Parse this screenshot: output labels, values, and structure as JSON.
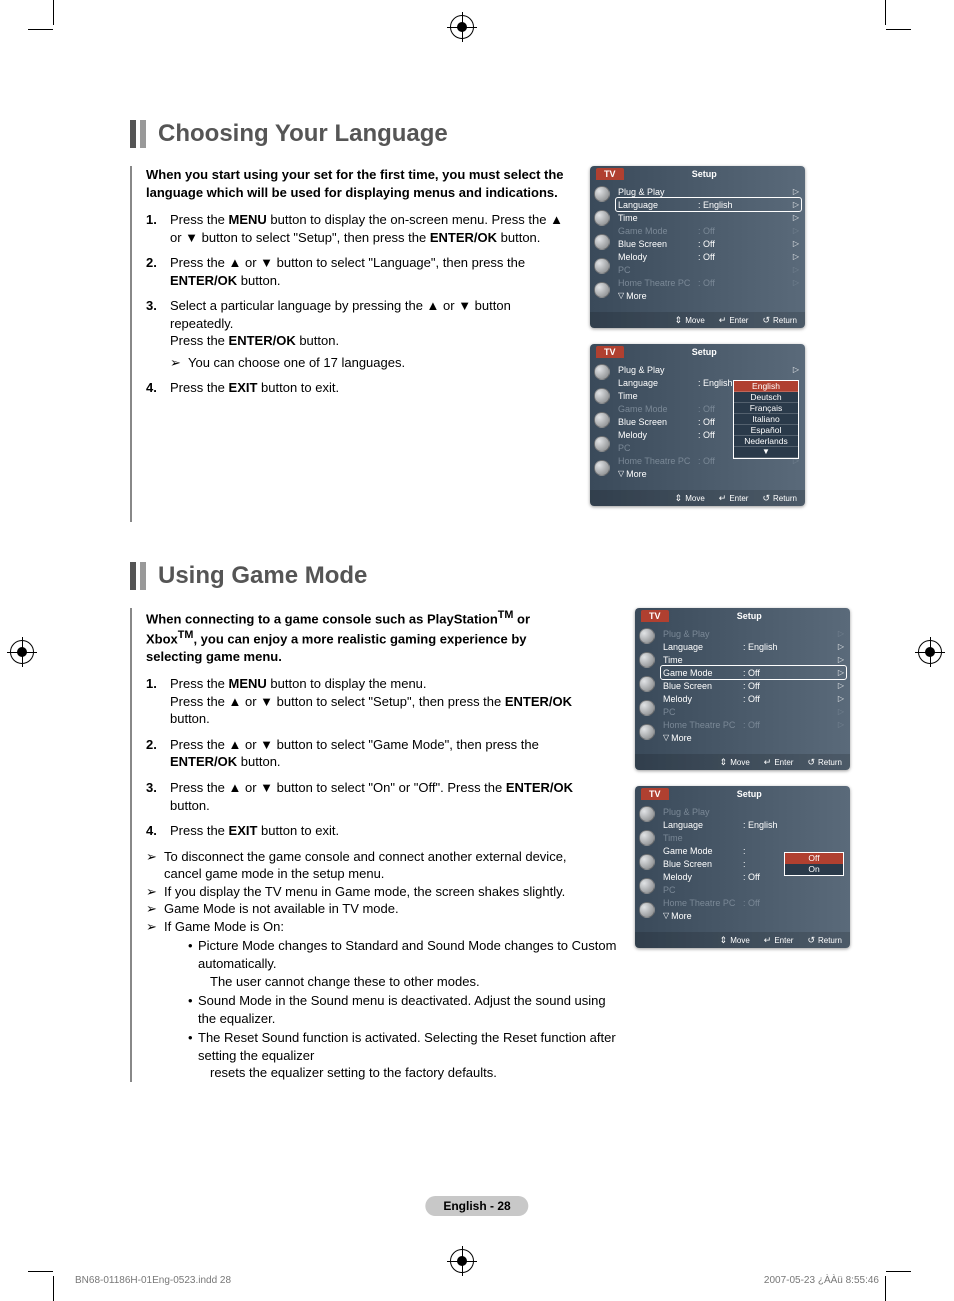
{
  "section1": {
    "title": "Choosing Your Language",
    "intro": "When you start using your set for the first time, you must select the language which will be used for displaying menus and indications.",
    "steps": [
      {
        "num": "1.",
        "html": "Press the <b>MENU</b> button to display the on-screen menu. Press the ▲ or ▼ button to select \"Setup\", then press the <b>ENTER/OK</b> button."
      },
      {
        "num": "2.",
        "html": "Press the ▲ or ▼ button to select \"Language\", then press the <b>ENTER/OK</b> button."
      },
      {
        "num": "3.",
        "html": "Select a particular language by pressing the ▲ or ▼ button repeatedly.<br>Press the <b>ENTER/OK</b> button.",
        "note": "You can choose one of 17 languages."
      },
      {
        "num": "4.",
        "html": "Press the <b>EXIT</b> button to exit."
      }
    ]
  },
  "section2": {
    "title": "Using Game Mode",
    "intro_html": "When connecting to a game console such as PlayStation<sup>TM</sup> or Xbox<sup>TM</sup>, you can enjoy a more realistic gaming experience by selecting game menu.",
    "steps": [
      {
        "num": "1.",
        "html": "Press the <b>MENU</b> button to display the menu.<br>Press the ▲ or ▼ button to select \"Setup\", then press the <b>ENTER/OK</b> button."
      },
      {
        "num": "2.",
        "html": "Press the ▲ or ▼ button to select \"Game Mode\", then press the <b>ENTER/OK</b> button."
      },
      {
        "num": "3.",
        "html": "Press the ▲ or ▼ button to select \"On\" or \"Off\". Press the <b>ENTER/OK</b> button."
      },
      {
        "num": "4.",
        "html": "Press the <b>EXIT</b> button to exit."
      }
    ],
    "notes": [
      "To disconnect the game console and connect another external device, cancel game mode in the setup menu.",
      "If you display the TV menu in Game mode, the screen shakes slightly.",
      "Game Mode is not available in TV mode.",
      "If Game Mode is On:"
    ],
    "sub_bullets": [
      {
        "t": "Picture Mode changes to Standard and Sound Mode changes to Custom automatically.",
        "t2": "The user cannot change these to other modes."
      },
      {
        "t": "Sound Mode in the Sound menu is deactivated. Adjust the sound using the equalizer."
      },
      {
        "t": "The Reset Sound function is activated. Selecting the Reset function after setting the equalizer",
        "t2": "resets the equalizer setting to the factory defaults."
      }
    ]
  },
  "osd": {
    "tv": "TV",
    "setup": "Setup",
    "rows_std": [
      {
        "label": "Plug & Play",
        "val": "",
        "tri": true
      },
      {
        "label": "Language",
        "val": ": English",
        "tri": true
      },
      {
        "label": "Time",
        "val": "",
        "tri": true
      },
      {
        "label": "Game Mode",
        "val": ": Off",
        "tri": true,
        "dim": true
      },
      {
        "label": "Blue Screen",
        "val": ": Off",
        "tri": true
      },
      {
        "label": "Melody",
        "val": ": Off",
        "tri": true
      },
      {
        "label": "PC",
        "val": "",
        "tri": true,
        "dim": true
      },
      {
        "label": "Home Theatre PC",
        "val": ": Off",
        "tri": true,
        "dim": true
      }
    ],
    "more": "More",
    "footer": {
      "move": "Move",
      "enter": "Enter",
      "return": "Return"
    },
    "languages": [
      "English",
      "Deutsch",
      "Français",
      "Italiano",
      "Español",
      "Nederlands"
    ],
    "game_opts": [
      "Off",
      "On"
    ],
    "osd3_rows": [
      {
        "label": "Plug & Play",
        "val": "",
        "tri": true,
        "dim": true
      },
      {
        "label": "Language",
        "val": ": English",
        "tri": true
      },
      {
        "label": "Time",
        "val": "",
        "tri": true
      },
      {
        "label": "Game Mode",
        "val": ": Off",
        "tri": true,
        "sel": true
      },
      {
        "label": "Blue Screen",
        "val": ": Off",
        "tri": true
      },
      {
        "label": "Melody",
        "val": ": Off",
        "tri": true
      },
      {
        "label": "PC",
        "val": "",
        "tri": true,
        "dim": true
      },
      {
        "label": "Home Theatre PC",
        "val": ": Off",
        "tri": true,
        "dim": true
      }
    ],
    "osd4_rows": [
      {
        "label": "Plug & Play",
        "val": "",
        "dim": true
      },
      {
        "label": "Language",
        "val": ": English"
      },
      {
        "label": "Time",
        "val": "",
        "dim": true
      },
      {
        "label": "Game Mode",
        "val": ":"
      },
      {
        "label": "Blue Screen",
        "val": ":"
      },
      {
        "label": "Melody",
        "val": ": Off"
      },
      {
        "label": "PC",
        "val": "",
        "dim": true
      },
      {
        "label": "Home Theatre PC",
        "val": ": Off",
        "dim": true
      }
    ]
  },
  "page_num": "English - 28",
  "footer_left": "BN68-01186H-01Eng-0523.indd   28",
  "footer_right": "2007-05-23   ¿ÀÀü 8:55:46"
}
